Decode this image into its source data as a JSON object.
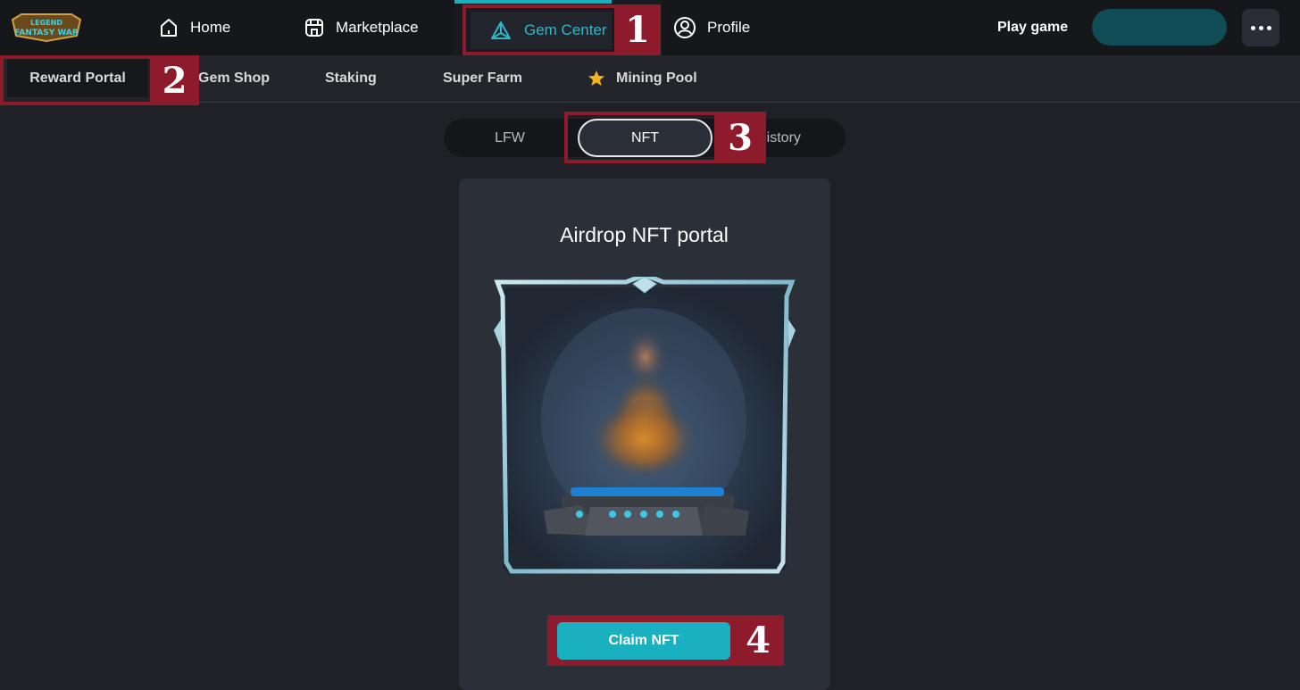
{
  "topnav": {
    "logo_text": "LEGEND OF FANTASY WAR",
    "items": [
      {
        "label": "Home",
        "icon": "home-icon"
      },
      {
        "label": "Marketplace",
        "icon": "store-icon"
      },
      {
        "label": "Gem Center",
        "icon": "gem-icon"
      },
      {
        "label": "Profile",
        "icon": "user-icon"
      }
    ],
    "play_game": "Play game",
    "accent_color": "#1ab0bd"
  },
  "subnav": {
    "items": [
      {
        "label": "Reward Portal"
      },
      {
        "label": "Gem Shop"
      },
      {
        "label": "Staking"
      },
      {
        "label": "Super Farm"
      },
      {
        "label": "Mining Pool",
        "icon": "star-icon"
      }
    ]
  },
  "tabs": [
    {
      "label": "LFW"
    },
    {
      "label": "NFT"
    },
    {
      "label": "History"
    }
  ],
  "card": {
    "title": "Airdrop NFT portal",
    "claim_label": "Claim NFT"
  },
  "annotations": [
    "1",
    "2",
    "3",
    "4"
  ]
}
